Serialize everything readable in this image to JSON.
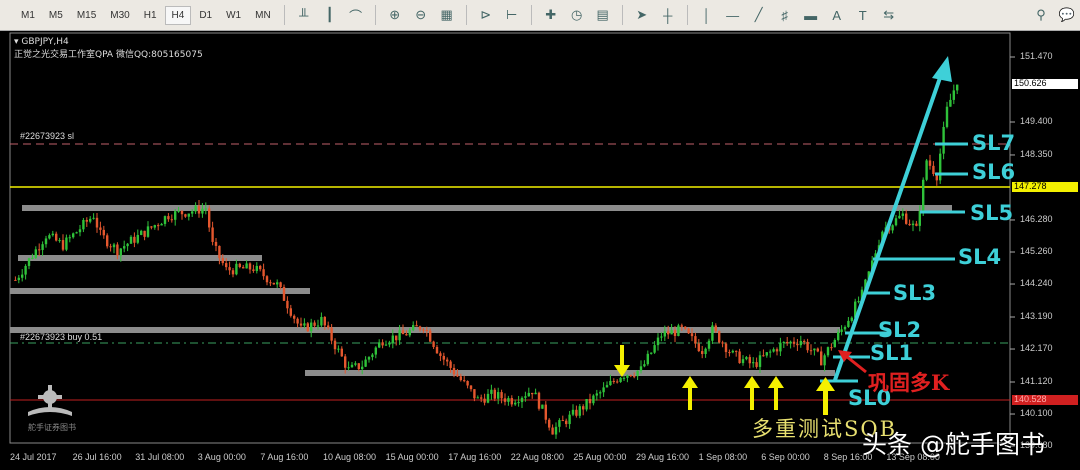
{
  "toolbar": {
    "timeframes": [
      "M1",
      "M5",
      "M15",
      "M30",
      "H1",
      "H4",
      "D1",
      "W1",
      "MN"
    ],
    "active": "H4"
  },
  "chart": {
    "symbol": "GBPJPY,H4",
    "subtitle": "正觉之光交易工作室QPA 微信QQ:805165075",
    "sl_order_label": "#22673923 sl",
    "buy_order_label": "#22673923 buy 0.51",
    "bid": "150.626",
    "ask_line": "147.278",
    "red_line": "140.528",
    "price_ticks": [
      "151.470",
      "149.400",
      "148.350",
      "146.280",
      "145.260",
      "144.240",
      "143.190",
      "142.170",
      "141.120",
      "140.100",
      "139.080"
    ],
    "time_ticks": [
      "24 Jul 2017",
      "26 Jul 16:00",
      "31 Jul 08:00",
      "3 Aug 00:00",
      "7 Aug 16:00",
      "10 Aug 08:00",
      "15 Aug 00:00",
      "17 Aug 16:00",
      "22 Aug 08:00",
      "25 Aug 00:00",
      "29 Aug 16:00",
      "1 Sep 08:00",
      "6 Sep 00:00",
      "8 Sep 16:00",
      "13 Sep 08:00"
    ]
  },
  "annotations": {
    "sl_labels": [
      "SL0",
      "SL1",
      "SL2",
      "SL3",
      "SL4",
      "SL5",
      "SL6",
      "SL7"
    ],
    "multi_test": "多重测试SOB",
    "consolidate": "巩固多K"
  },
  "watermark": "头条 @舵手图书",
  "logo_text": "舵手证券图书",
  "colors": {
    "bull": "#2fc23a",
    "bear": "#e4572e",
    "cyan": "#3ed0d8",
    "level": "#8a8a8a",
    "yellow": "#f3f000"
  },
  "chart_data": {
    "type": "candlestick",
    "symbol": "GBPJPY",
    "timeframe": "H4",
    "ylim": [
      139.0,
      152.0
    ],
    "path": [
      [
        1,
        144.37
      ],
      [
        10,
        145.8
      ],
      [
        15,
        145.48
      ],
      [
        24,
        146.44
      ],
      [
        26,
        145.8
      ],
      [
        31,
        145.32
      ],
      [
        40,
        145.96
      ],
      [
        46,
        146.44
      ],
      [
        51,
        146.53
      ],
      [
        57,
        146.66
      ],
      [
        59,
        145.48
      ],
      [
        63,
        144.69
      ],
      [
        71,
        144.75
      ],
      [
        78,
        144.21
      ],
      [
        85,
        142.78
      ],
      [
        91,
        143.09
      ],
      [
        99,
        141.5
      ],
      [
        103,
        141.66
      ],
      [
        109,
        142.46
      ],
      [
        115,
        142.62
      ],
      [
        121,
        142.93
      ],
      [
        126,
        141.98
      ],
      [
        132,
        141.18
      ],
      [
        137,
        140.55
      ],
      [
        141,
        140.71
      ],
      [
        147,
        140.55
      ],
      [
        153,
        140.86
      ],
      [
        159,
        139.59
      ],
      [
        165,
        140.07
      ],
      [
        174,
        140.86
      ],
      [
        179,
        141.34
      ],
      [
        185,
        141.5
      ],
      [
        191,
        142.62
      ],
      [
        197,
        142.78
      ],
      [
        203,
        142.14
      ],
      [
        206,
        142.78
      ],
      [
        212,
        141.98
      ],
      [
        218,
        141.66
      ],
      [
        226,
        142.3
      ],
      [
        232,
        142.46
      ],
      [
        238,
        141.82
      ],
      [
        244,
        142.78
      ],
      [
        250,
        143.89
      ],
      [
        256,
        145.96
      ],
      [
        262,
        146.44
      ],
      [
        266,
        145.96
      ],
      [
        269,
        148.19
      ],
      [
        272,
        147.71
      ],
      [
        275,
        149.78
      ],
      [
        278,
        150.74
      ]
    ]
  }
}
